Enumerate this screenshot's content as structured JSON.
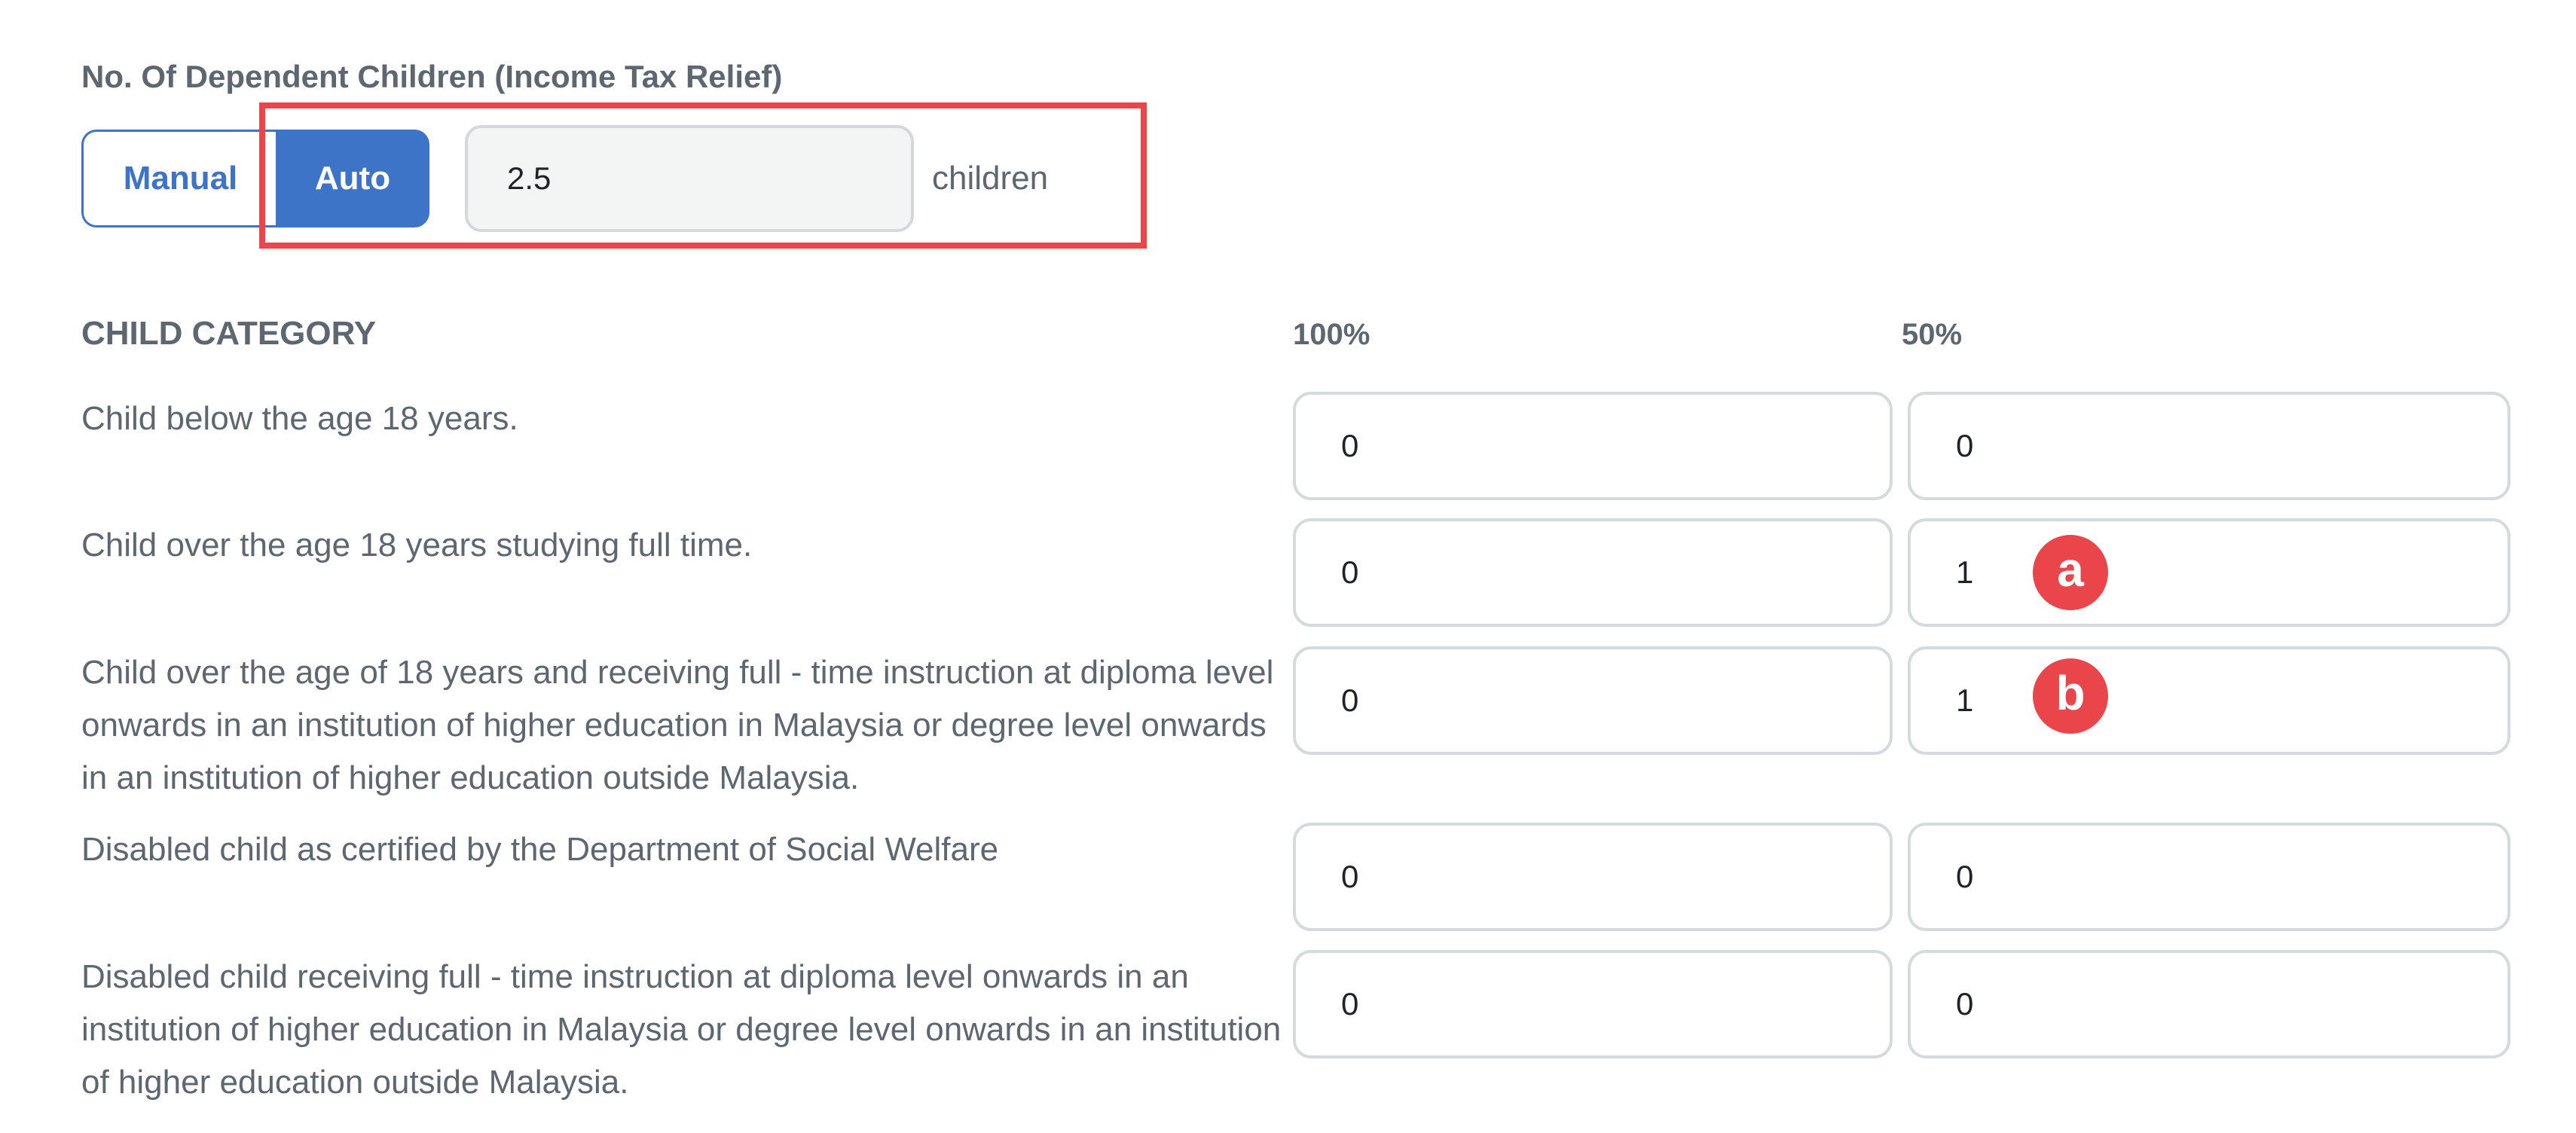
{
  "header": {
    "title": "No. Of Dependent Children (Income Tax Relief)",
    "mode_manual_label": "Manual",
    "mode_auto_label": "Auto",
    "selected_mode": "Auto",
    "children_count": "2.5",
    "unit_label": "children"
  },
  "table": {
    "category_header": "CHILD CATEGORY",
    "col_100_header": "100%",
    "col_50_header": "50%",
    "rows": [
      {
        "label": "Child below the age 18 years.",
        "v100": "0",
        "v50": "0"
      },
      {
        "label": "Child over the age 18 years studying full time.",
        "v100": "0",
        "v50": "1",
        "annotation": "a"
      },
      {
        "label": "Child over the age of 18 years and receiving full - time instruction at diploma level onwards in an institution of higher education in Malaysia or degree level onwards in an institution of higher education outside Malaysia.",
        "v100": "0",
        "v50": "1",
        "annotation": "b"
      },
      {
        "label": "Disabled child as certified by the Department of Social Welfare",
        "v100": "0",
        "v50": "0"
      },
      {
        "label": "Disabled child receiving full - time instruction at diploma level onwards in an institution of higher education in Malaysia or degree level onwards in an institution of higher education outside Malaysia.",
        "v100": "0",
        "v50": "0"
      }
    ]
  },
  "colors": {
    "accent_blue": "#3e74c7",
    "highlight_red": "#e9454a",
    "field_border": "#d5dadc",
    "text_gray": "#5e6670"
  }
}
